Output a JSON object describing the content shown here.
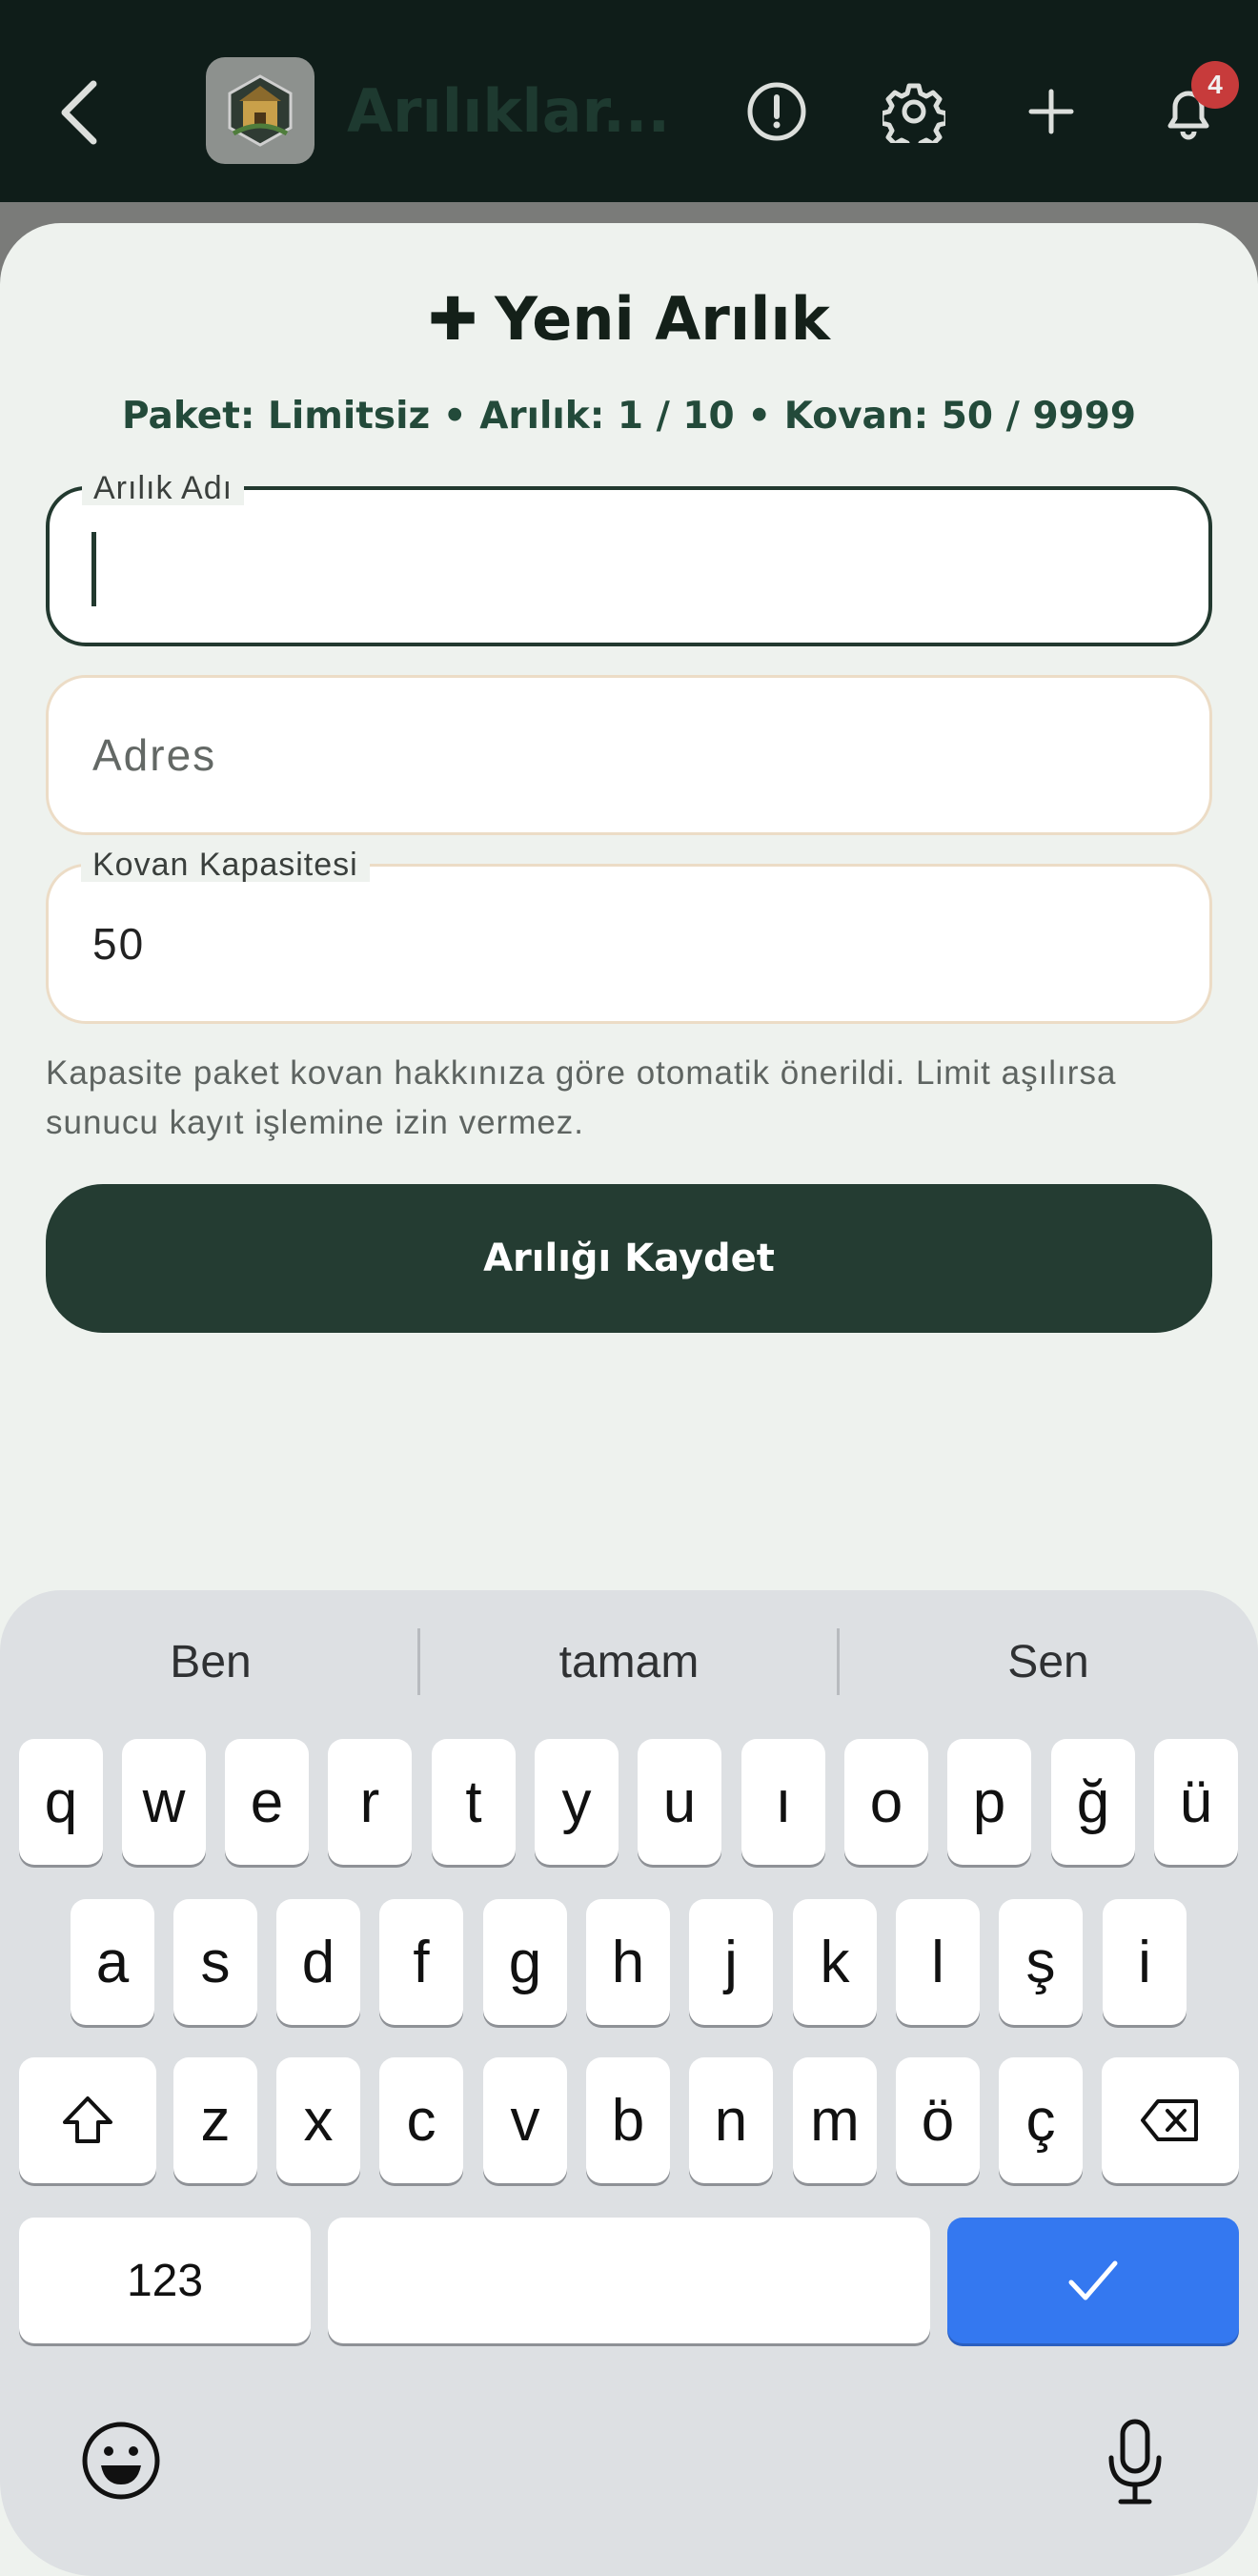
{
  "header": {
    "title": "Arılıklar...",
    "notification_count": "4"
  },
  "sheet": {
    "title": "Yeni Arılık",
    "quota": "Paket: Limitsiz • Arılık: 1 / 10 • Kovan: 50 / 9999",
    "fields": {
      "name": {
        "label": "Arılık Adı",
        "value": ""
      },
      "address": {
        "placeholder": "Adres"
      },
      "capacity": {
        "label": "Kovan Kapasitesi",
        "value": "50"
      }
    },
    "hint": "Kapasite paket kovan hakkınıza göre otomatik önerildi. Limit aşılırsa sunucu kayıt işlemine izin vermez.",
    "save_label": "Arılığı Kaydet"
  },
  "keyboard": {
    "suggestions": [
      "Ben",
      "tamam",
      "Sen"
    ],
    "row1": [
      "q",
      "w",
      "e",
      "r",
      "t",
      "y",
      "u",
      "ı",
      "o",
      "p",
      "ğ",
      "ü"
    ],
    "row2": [
      "a",
      "s",
      "d",
      "f",
      "g",
      "h",
      "j",
      "k",
      "l",
      "ş",
      "i"
    ],
    "row3": [
      "z",
      "x",
      "c",
      "v",
      "b",
      "n",
      "m",
      "ö",
      "ç"
    ],
    "numbers_label": "123",
    "accent_color": "#3478f0"
  },
  "colors": {
    "primary": "#243c32",
    "topbar": "#0f1d19",
    "sheet_bg": "#eef2ee",
    "badge": "#c73b3b"
  }
}
